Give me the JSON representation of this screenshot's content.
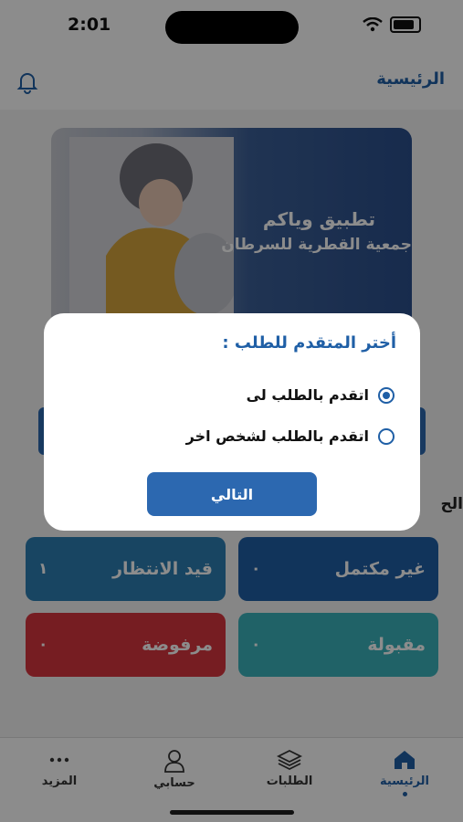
{
  "status_bar": {
    "time": "2:01"
  },
  "header": {
    "title": "الرئيسية"
  },
  "banner": {
    "title": "تطبيق وياكم",
    "subtitle": "جمعية القطرية للسرطان"
  },
  "section": {
    "label": "الح"
  },
  "cards": [
    {
      "label": "غير مكتمل",
      "count": "٠",
      "color": "#1f5fa6"
    },
    {
      "label": "قيد الانتظار",
      "count": "١",
      "color": "#2c7fb2"
    },
    {
      "label": "مقبولة",
      "count": "٠",
      "color": "#3bb3bc"
    },
    {
      "label": "مرفوضة",
      "count": "٠",
      "color": "#d8353f"
    }
  ],
  "tabbar": {
    "items": [
      {
        "label": "الرئيسية",
        "icon": "home-icon",
        "active": true
      },
      {
        "label": "الطلبات",
        "icon": "layers-icon",
        "active": false
      },
      {
        "label": "حسابي",
        "icon": "person-icon",
        "active": false
      },
      {
        "label": "المزيد",
        "icon": "more-icon",
        "active": false
      }
    ]
  },
  "dialog": {
    "title": "أختر المتقدم للطلب :",
    "options": [
      {
        "label": "اتقدم بالطلب لى",
        "selected": true
      },
      {
        "label": "اتقدم بالطلب لشخص اخر",
        "selected": false
      }
    ],
    "next_label": "التالي"
  },
  "colors": {
    "primary": "#1f5fa6",
    "button": "#2c68b0"
  }
}
